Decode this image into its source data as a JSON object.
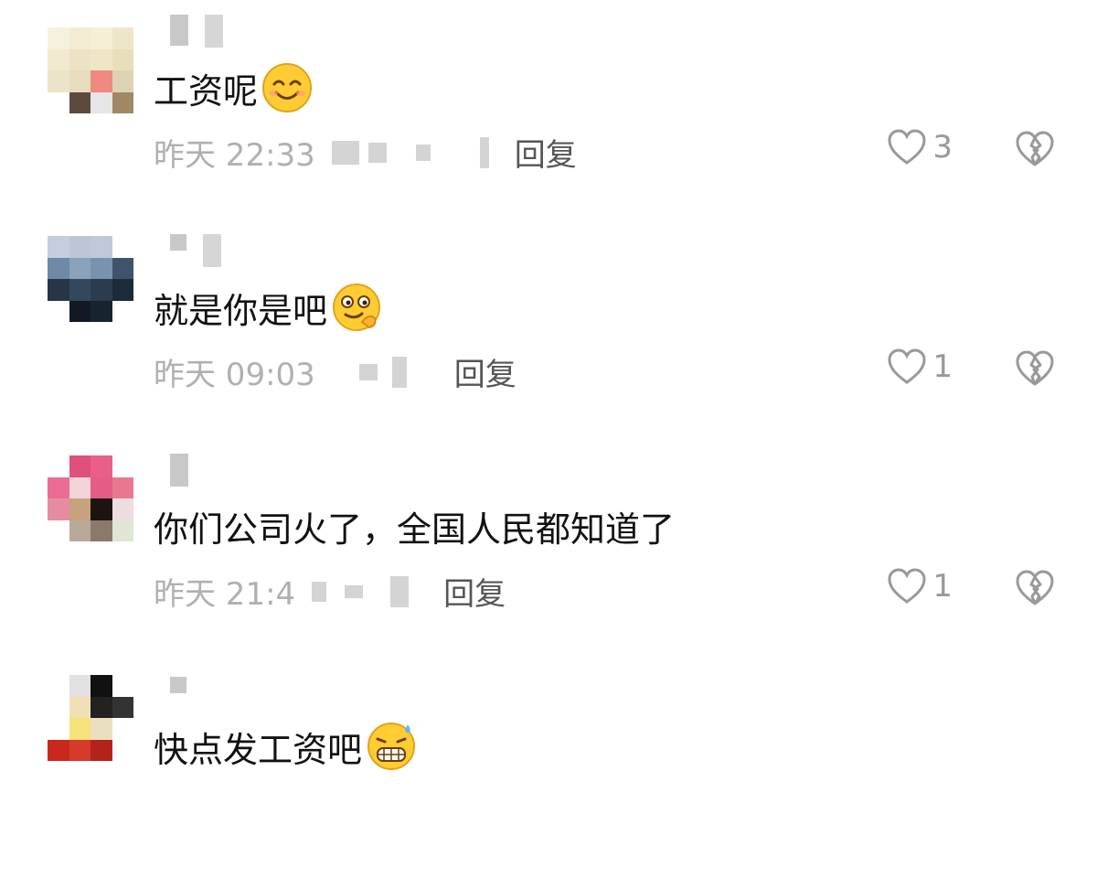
{
  "comments": [
    {
      "text": "工资呢",
      "emoji": "smiling-emoji",
      "time": "昨天 22:33",
      "reply": "回复",
      "likes": "3"
    },
    {
      "text": "就是你是吧",
      "emoji": "thinking-emoji",
      "time": "昨天 09:03",
      "reply": "回复",
      "likes": "1"
    },
    {
      "text": "你们公司火了，全国人民都知道了",
      "emoji": "",
      "time": "昨天 21:4",
      "reply": "回复",
      "likes": "1"
    },
    {
      "text": "快点发工资吧",
      "emoji": "grimace-sweat-emoji",
      "time": "",
      "reply": "",
      "likes": ""
    }
  ],
  "colors": {
    "text": "#111111",
    "meta": "#b0b0b0",
    "icon": "#999999"
  }
}
